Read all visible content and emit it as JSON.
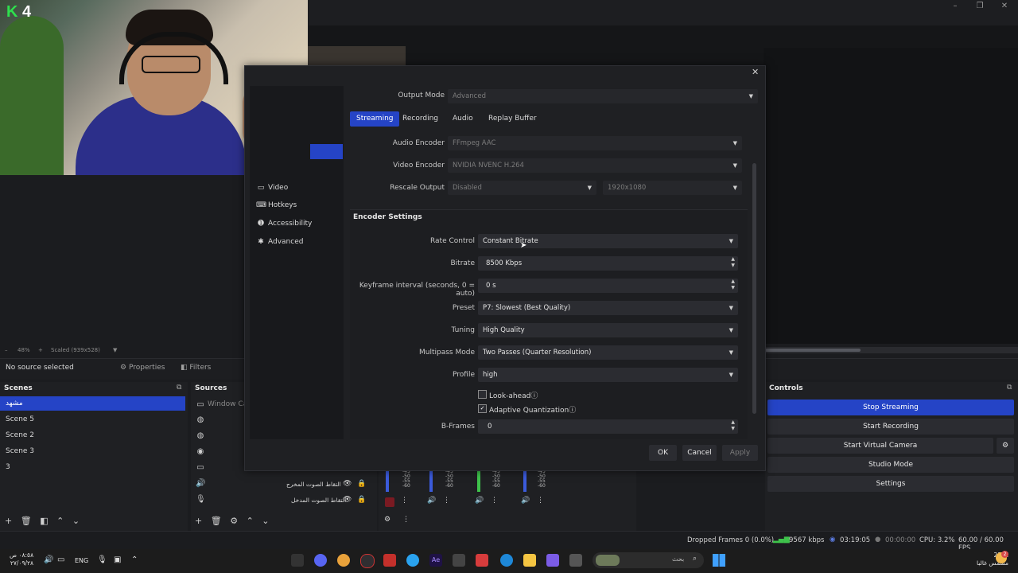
{
  "overlay": {
    "logo_k": "K",
    "logo_num": "4"
  },
  "preview": {
    "zoom": "48%",
    "scale": "Scaled (939x528)"
  },
  "context_bar": {
    "no_source": "No source selected",
    "properties": "Properties",
    "filters": "Filters"
  },
  "scenes": {
    "title": "Scenes",
    "items": [
      {
        "label": "مشهد",
        "selected": true
      },
      {
        "label": "Scene 5",
        "selected": false
      },
      {
        "label": "Scene 2",
        "selected": false
      },
      {
        "label": "Scene 3",
        "selected": false
      },
      {
        "label": "3",
        "selected": false
      }
    ]
  },
  "sources": {
    "title": "Sources",
    "first": "Window Ca",
    "audio_out": "التقاط الصوت المخرج",
    "audio_in": "التقاط الصوت المدخل"
  },
  "mixer": {
    "scale": [
      "-45",
      "-50",
      "-55",
      "-60"
    ]
  },
  "controls": {
    "title": "Controls",
    "stop_streaming": "Stop Streaming",
    "start_recording": "Start Recording",
    "start_virtual_camera": "Start Virtual Camera",
    "studio_mode": "Studio Mode",
    "settings": "Settings"
  },
  "status": {
    "dropped_frames": "Dropped Frames 0 (0.0%)",
    "bitrate": "9567 kbps",
    "stream_time": "03:19:05",
    "rec_time": "00:00:00",
    "cpu": "CPU: 3.2%",
    "fps": "60.00 / 60.00 FPS"
  },
  "settings_dialog": {
    "nav": [
      {
        "label": "Video",
        "icon": "monitor-icon"
      },
      {
        "label": "Hotkeys",
        "icon": "keyboard-icon"
      },
      {
        "label": "Accessibility",
        "icon": "accessibility-icon"
      },
      {
        "label": "Advanced",
        "icon": "wrench-icon"
      }
    ],
    "output_mode_label": "Output Mode",
    "output_mode_value": "Advanced",
    "tabs": [
      "Streaming",
      "Recording",
      "Audio",
      "Replay Buffer"
    ],
    "audio_encoder_label": "Audio Encoder",
    "audio_encoder_value": "FFmpeg AAC",
    "video_encoder_label": "Video Encoder",
    "video_encoder_value": "NVIDIA NVENC H.264",
    "rescale_label": "Rescale Output",
    "rescale_value": "Disabled",
    "rescale_res": "1920x1080",
    "encoder_settings_title": "Encoder Settings",
    "rate_control_label": "Rate Control",
    "rate_control_value": "Constant Bitrate",
    "bitrate_label": "Bitrate",
    "bitrate_value": "8500 Kbps",
    "keyframe_label": "Keyframe interval (seconds, 0 = auto)",
    "keyframe_value": "0 s",
    "preset_label": "Preset",
    "preset_value": "P7: Slowest (Best Quality)",
    "tuning_label": "Tuning",
    "tuning_value": "High Quality",
    "multipass_label": "Multipass Mode",
    "multipass_value": "Two Passes (Quarter Resolution)",
    "profile_label": "Profile",
    "profile_value": "high",
    "lookahead_label": "Look-ahead",
    "lookahead_checked": false,
    "adaptive_label": "Adaptive Quantization",
    "adaptive_checked": true,
    "bframes_label": "B-Frames",
    "bframes_value": "0",
    "ok": "OK",
    "cancel": "Cancel",
    "apply": "Apply"
  },
  "taskbar": {
    "time": "٠٨:٥٨ ص",
    "date": "٢٧/٠٩/٢٨",
    "lang": "ENG",
    "search_placeholder": "بحث",
    "weather_temp": "23°C",
    "weather_desc": "مشمس غالبا",
    "notif_count": "2"
  }
}
